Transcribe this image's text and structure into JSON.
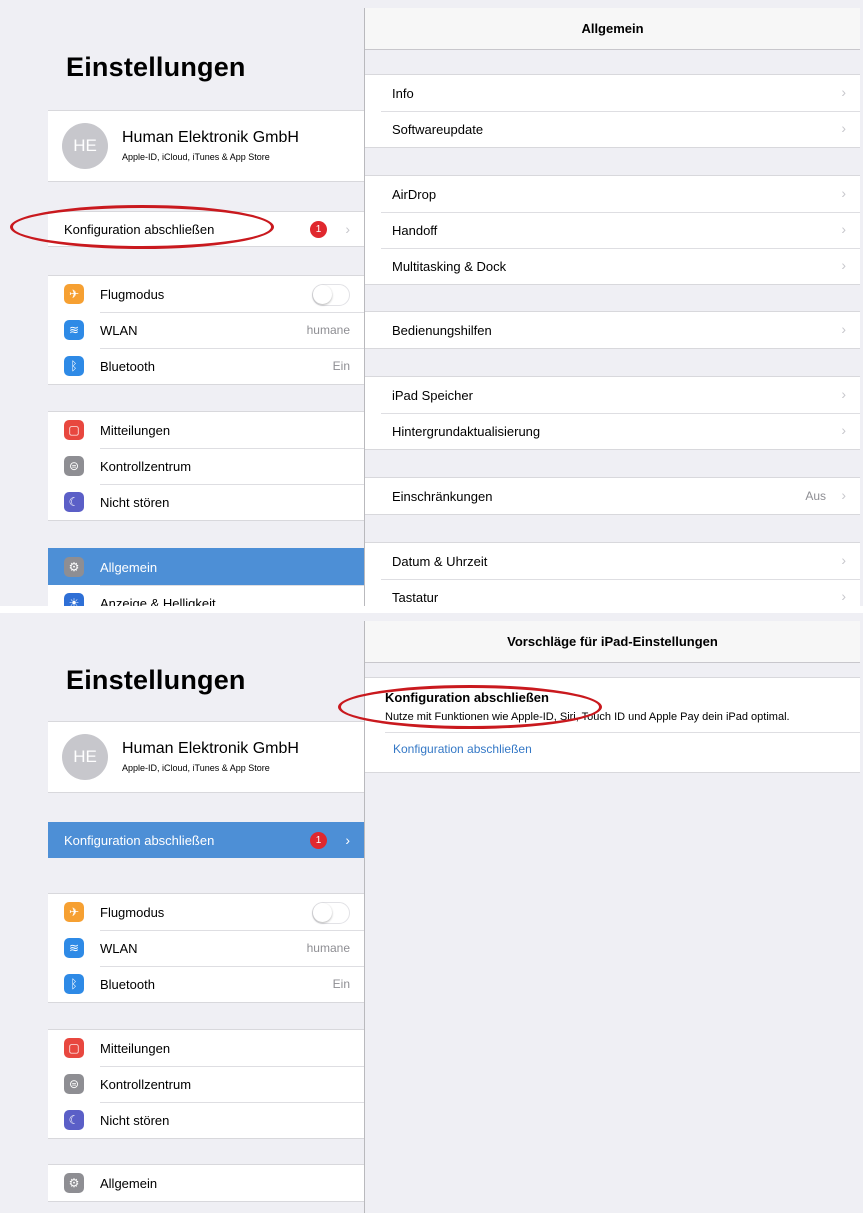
{
  "shot1": {
    "sidebar": {
      "title": "Einstellungen",
      "profile": {
        "initials": "HE",
        "name": "Human Elektronik GmbH",
        "subtitle": "Apple-ID, iCloud, iTunes & App Store"
      },
      "konfiguration": {
        "label": "Konfiguration abschließen",
        "badge": "1"
      },
      "connectivity": [
        {
          "label": "Flugmodus",
          "value": "",
          "icon": "airplane-icon",
          "color": "#f6a032"
        },
        {
          "label": "WLAN",
          "value": "humane",
          "icon": "wifi-icon",
          "color": "#2e8ae6"
        },
        {
          "label": "Bluetooth",
          "value": "Ein",
          "icon": "bluetooth-icon",
          "color": "#2e8ae6"
        }
      ],
      "notifications": [
        {
          "label": "Mitteilungen",
          "icon": "notifications-icon",
          "color": "#e8473f"
        },
        {
          "label": "Kontrollzentrum",
          "icon": "control-center-icon",
          "color": "#8e8e93"
        },
        {
          "label": "Nicht stören",
          "icon": "moon-icon",
          "color": "#5b5fc7"
        }
      ],
      "general": [
        {
          "label": "Allgemein",
          "icon": "gear-icon",
          "color": "#8e8e93"
        },
        {
          "label": "Anzeige & Helligkeit",
          "icon": "display-icon",
          "color": "#2e6fd6"
        }
      ]
    },
    "detail": {
      "nav_title": "Allgemein",
      "groups": [
        [
          {
            "label": "Info"
          },
          {
            "label": "Softwareupdate"
          }
        ],
        [
          {
            "label": "AirDrop"
          },
          {
            "label": "Handoff"
          },
          {
            "label": "Multitasking & Dock"
          }
        ],
        [
          {
            "label": "Bedienungshilfen"
          }
        ],
        [
          {
            "label": "iPad Speicher"
          },
          {
            "label": "Hintergrundaktualisierung"
          }
        ],
        [
          {
            "label": "Einschränkungen",
            "value": "Aus"
          }
        ],
        [
          {
            "label": "Datum & Uhrzeit"
          },
          {
            "label": "Tastatur"
          }
        ]
      ]
    }
  },
  "shot2": {
    "sidebar": {
      "title": "Einstellungen",
      "profile": {
        "initials": "HE",
        "name": "Human Elektronik GmbH",
        "subtitle": "Apple-ID, iCloud, iTunes & App Store"
      },
      "konfiguration": {
        "label": "Konfiguration abschließen",
        "badge": "1"
      },
      "connectivity": [
        {
          "label": "Flugmodus",
          "value": ""
        },
        {
          "label": "WLAN",
          "value": "humane"
        },
        {
          "label": "Bluetooth",
          "value": "Ein"
        }
      ],
      "notifications": [
        {
          "label": "Mitteilungen"
        },
        {
          "label": "Kontrollzentrum"
        },
        {
          "label": "Nicht stören"
        }
      ],
      "general": [
        {
          "label": "Allgemein"
        }
      ]
    },
    "detail": {
      "nav_title": "Vorschläge für iPad-Einstellungen",
      "suggestion": {
        "title": "Konfiguration abschließen",
        "description": "Nutze mit Funktionen wie Apple-ID, Siri, Touch ID und Apple Pay dein iPad optimal.",
        "link": "Konfiguration abschließen"
      }
    }
  },
  "colors": {
    "annotation": "#c9191e",
    "selection": "#4d8fd6",
    "badge": "#e0282e",
    "link": "#3478c6"
  }
}
